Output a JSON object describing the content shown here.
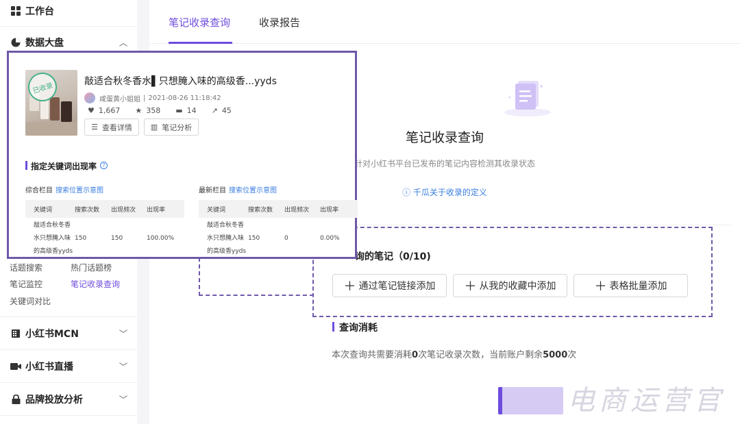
{
  "sidebar": {
    "workbench": "工作台",
    "data_dashboard": "数据大盘",
    "sub_items": [
      "话题搜索",
      "热门话题榜",
      "笔记监控",
      "笔记收录查询",
      "关键词对比"
    ],
    "mcn": "小红书MCN",
    "live": "小红书直播",
    "brand": "品牌投放分析"
  },
  "tabs": [
    "笔记收录查询",
    "收录报告"
  ],
  "hero": {
    "title": "笔记收录查询",
    "subtitle": "针对小红书平台已发布的笔记内容检测其收录状态",
    "link": "千瓜关于收录的定义"
  },
  "query": {
    "section_title": "询的笔记（0/10)",
    "buttons": [
      "通过笔记链接添加",
      "从我的收藏中添加",
      "表格批量添加"
    ]
  },
  "consumption": {
    "title": "查询消耗",
    "text_before": "本次查询共需要消耗",
    "count": "0",
    "text_middle": "次笔记收录次数，当前账户剩余",
    "remaining": "5000",
    "text_after": "次"
  },
  "watermark": "电商运营官",
  "popup": {
    "stamp": "已收录",
    "note_title": "敲适合秋冬香水▌只想腌入味的高级香...yyds",
    "author": "咸蛋黄小姐姐",
    "datetime": "2021-08-26 11:18:42",
    "likes": "1,667",
    "stars": "358",
    "comments": "14",
    "shares": "45",
    "btn_detail": "查看详情",
    "btn_analysis": "笔记分析",
    "keyword_section": "指定关键词出现率",
    "left_col": {
      "name": "综合栏目",
      "link": "搜索位置示意图"
    },
    "right_col": {
      "name": "最新栏目",
      "link": "搜索位置示意图"
    },
    "table_headers": [
      "关键词",
      "搜索次数",
      "出现频次",
      "出现率"
    ],
    "left_row": {
      "kw1": "敲适合秋冬香",
      "kw2": "水只想腌入味",
      "kw3": "的高级香yyds",
      "search": "150",
      "freq": "150",
      "rate": "100.00%"
    },
    "right_row": {
      "kw1": "敲适合秋冬香",
      "kw2": "水只想腌入味",
      "kw3": "的高级香yyds",
      "search": "150",
      "freq": "0",
      "rate": "0.00%"
    }
  }
}
